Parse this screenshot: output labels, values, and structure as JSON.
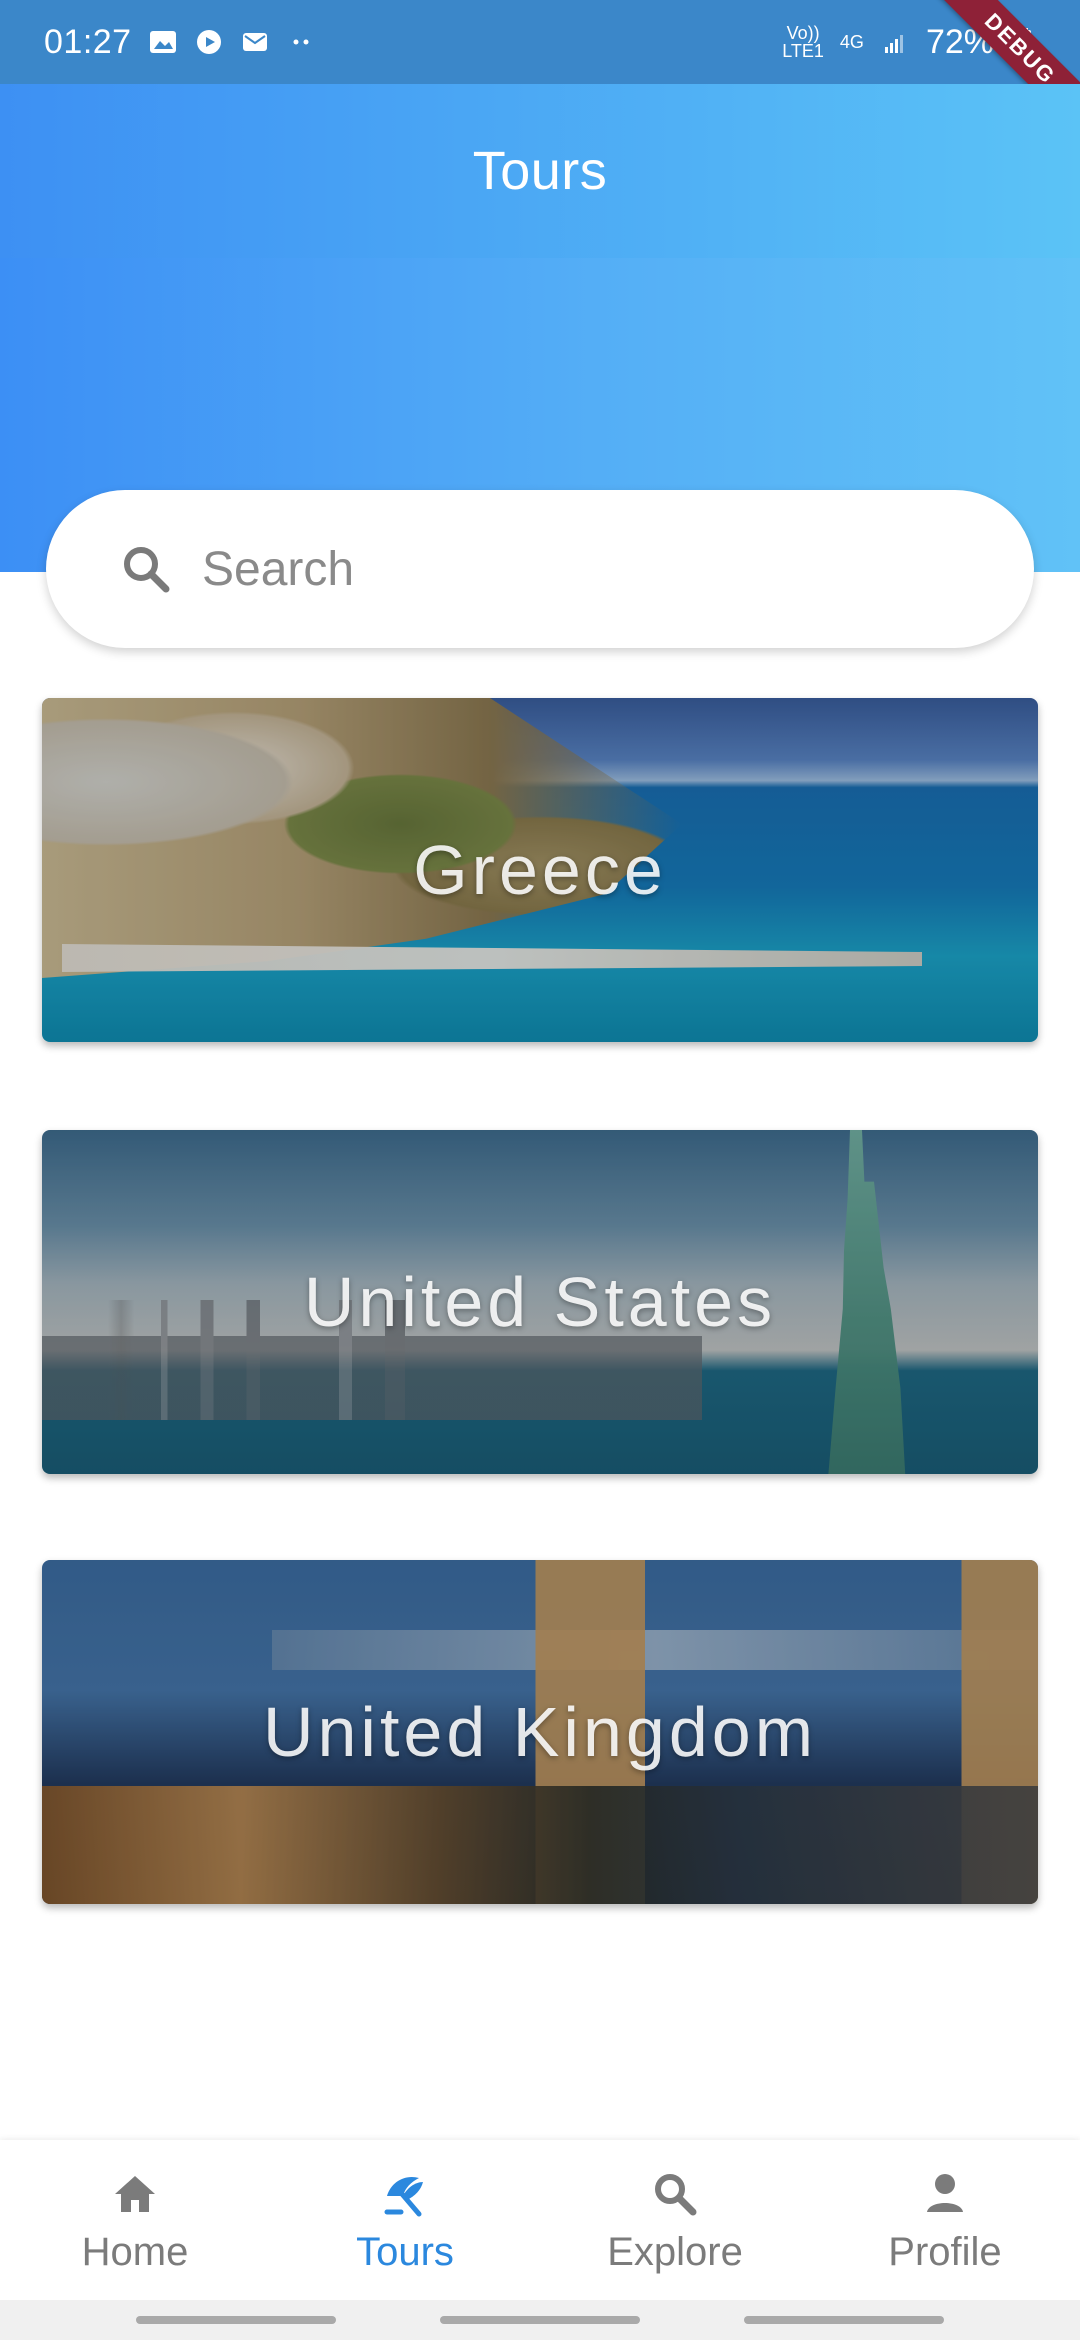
{
  "status_bar": {
    "time": "01:27",
    "network_top": "Vo))",
    "network_bottom": "LTE1",
    "signal_label": "4G",
    "battery": "72%",
    "icons": [
      "image-icon",
      "play-circle-icon",
      "mail-icon",
      "more-dots-icon",
      "signal-icon",
      "battery-icon"
    ]
  },
  "debug": {
    "label": "DEBUG",
    "color": "#8e2137"
  },
  "app_bar": {
    "title": "Tours"
  },
  "search": {
    "placeholder": "Search"
  },
  "cards": [
    {
      "title": "Greece"
    },
    {
      "title": "United States"
    },
    {
      "title": "United Kingdom"
    }
  ],
  "bottom_nav": {
    "items": [
      {
        "label": "Home",
        "icon": "home-icon"
      },
      {
        "label": "Tours",
        "icon": "beach-umbrella-icon",
        "active": true
      },
      {
        "label": "Explore",
        "icon": "search-icon"
      },
      {
        "label": "Profile",
        "icon": "person-icon"
      }
    ],
    "active_color": "#2b88de",
    "inactive_color": "#7b7b7b"
  },
  "colors": {
    "status_bar": "#3b87c9",
    "header_start": "#3d90f3",
    "header_end": "#5bc3f6"
  }
}
